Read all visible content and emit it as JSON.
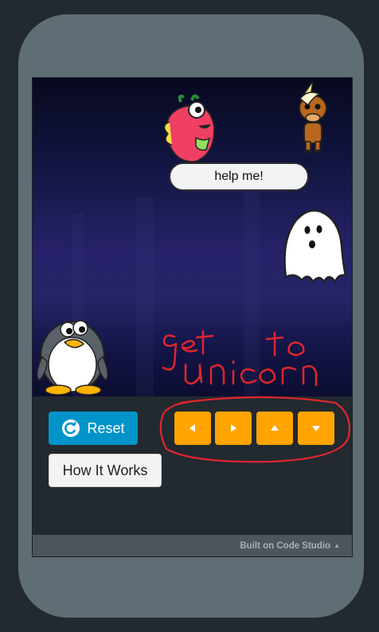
{
  "stage": {
    "speech_bubble": "help me!",
    "handwritten_note": [
      "get to",
      "unicorn"
    ]
  },
  "controls": {
    "reset_label": "Reset",
    "how_it_works_label": "How It Works",
    "arrows": [
      "left",
      "right",
      "up",
      "down"
    ]
  },
  "footer": {
    "text": "Built on Code Studio",
    "caret": "▲"
  },
  "colors": {
    "reset_button": "#0094ca",
    "arrow_buttons": "#ffa400",
    "annotation": "#e0262c"
  }
}
